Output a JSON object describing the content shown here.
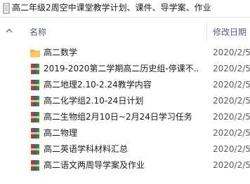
{
  "window": {
    "title": "高二年级2周空中课堂教学计划、课件、导学案、作业"
  },
  "columns": {
    "name": "名称",
    "modified": "修改日期"
  },
  "files": [
    {
      "name": "高二数学",
      "date": "2020/2/5",
      "type": "folder"
    },
    {
      "name": "2019-2020第二学期高二历史组-停课不...",
      "date": "2020/2/5",
      "type": "archive"
    },
    {
      "name": "高二地理2.10-2.24教学内容",
      "date": "2020/2/5",
      "type": "archive"
    },
    {
      "name": "高二化学组2.10-24日计划",
      "date": "2020/2/5",
      "type": "archive"
    },
    {
      "name": "高二生物组2月10日~2月24日学习任务",
      "date": "2020/2/5",
      "type": "archive"
    },
    {
      "name": "高二物理",
      "date": "2020/2/5",
      "type": "archive"
    },
    {
      "name": "高二英语学科材料汇总",
      "date": "2020/2/5",
      "type": "archive"
    },
    {
      "name": "高二语文两周导学案及作业",
      "date": "2020/2/5",
      "type": "archive"
    }
  ],
  "colors": {
    "folder": "#f2c14e",
    "archive_red": "#c0392b",
    "archive_blue": "#2e5fa8",
    "archive_green": "#3b8a3b",
    "header_text": "#4d6082"
  }
}
